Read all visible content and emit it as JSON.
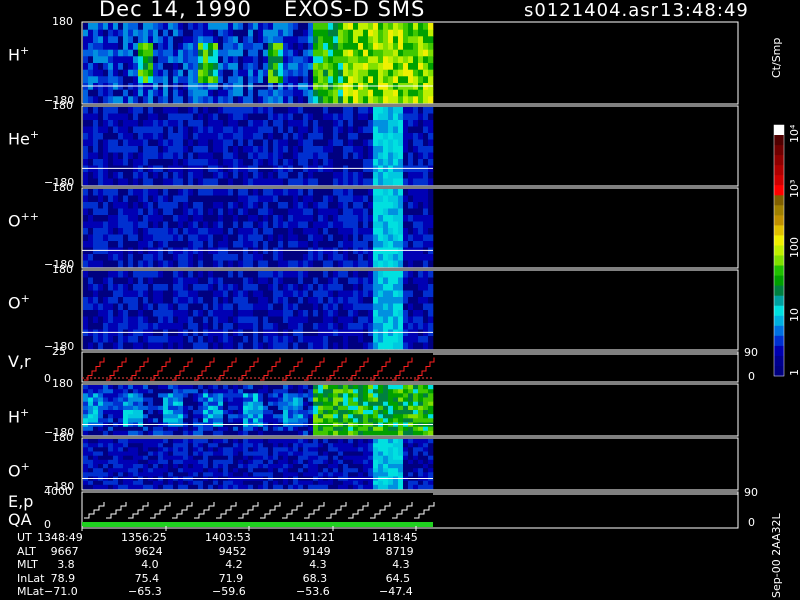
{
  "header": {
    "date": "Dec 14, 1990",
    "instrument": "EXOS-D SMS",
    "file": "s0121404.asr",
    "time": "13:48:49"
  },
  "colorbar": {
    "unit": "Ct/Smp",
    "ticks": [
      "1",
      "10",
      "100",
      "10³",
      "10⁴"
    ],
    "colors": [
      "#000080",
      "#00008f",
      "#0000b0",
      "#0030d0",
      "#0070e0",
      "#00b0e0",
      "#00e0e0",
      "#00a0a0",
      "#008040",
      "#00a000",
      "#20c000",
      "#80e000",
      "#c0f000",
      "#f0f000",
      "#e0c000",
      "#c09000",
      "#a08000",
      "#806000",
      "#ff0000",
      "#d00000",
      "#b00000",
      "#900000",
      "#700000",
      "#500000",
      "#ffffff"
    ]
  },
  "chart_data": {
    "type": "heatmap",
    "panels": [
      {
        "name": "H",
        "sup": "+",
        "ymin": "−180",
        "ymax": "180"
      },
      {
        "name": "He",
        "sup": "+",
        "ymin": "−180",
        "ymax": "180"
      },
      {
        "name": "O",
        "sup": "++",
        "ymin": "−180",
        "ymax": "180"
      },
      {
        "name": "O",
        "sup": "+",
        "ymin": "−180",
        "ymax": "180"
      },
      {
        "name": "V,r",
        "sup": "",
        "ymin": "0",
        "ymax": "25",
        "right_min": "0",
        "right_max": "90"
      },
      {
        "name": "H",
        "sup": "+",
        "ymin": "−180",
        "ymax": "180"
      },
      {
        "name": "O",
        "sup": "+",
        "ymin": "−180",
        "ymax": "180"
      },
      {
        "name": "E,p",
        "name2": "QA",
        "sup": "",
        "ymin": "0",
        "ymax": "4000",
        "right_min": "0",
        "right_max": "90"
      }
    ],
    "time_axis": {
      "labels": [
        "UT",
        "ALT",
        "MLT",
        "InLat",
        "MLat"
      ],
      "columns": [
        {
          "UT": "1348:49",
          "ALT": "9667",
          "MLT": "3.8",
          "InLat": "78.9",
          "MLat": "−71.0"
        },
        {
          "UT": "1356:25",
          "ALT": "9624",
          "MLT": "4.0",
          "InLat": "75.4",
          "MLat": "−65.3"
        },
        {
          "UT": "1403:53",
          "ALT": "9452",
          "MLT": "4.2",
          "InLat": "71.9",
          "MLat": "−59.6"
        },
        {
          "UT": "1411:21",
          "ALT": "9149",
          "MLT": "4.3",
          "InLat": "68.3",
          "MLat": "−53.6"
        },
        {
          "UT": "1418:45",
          "ALT": "8719",
          "MLT": "4.3",
          "InLat": "64.5",
          "MLat": "−47.4"
        }
      ]
    }
  },
  "footer": {
    "version": "Sep-00 2AA32L"
  }
}
